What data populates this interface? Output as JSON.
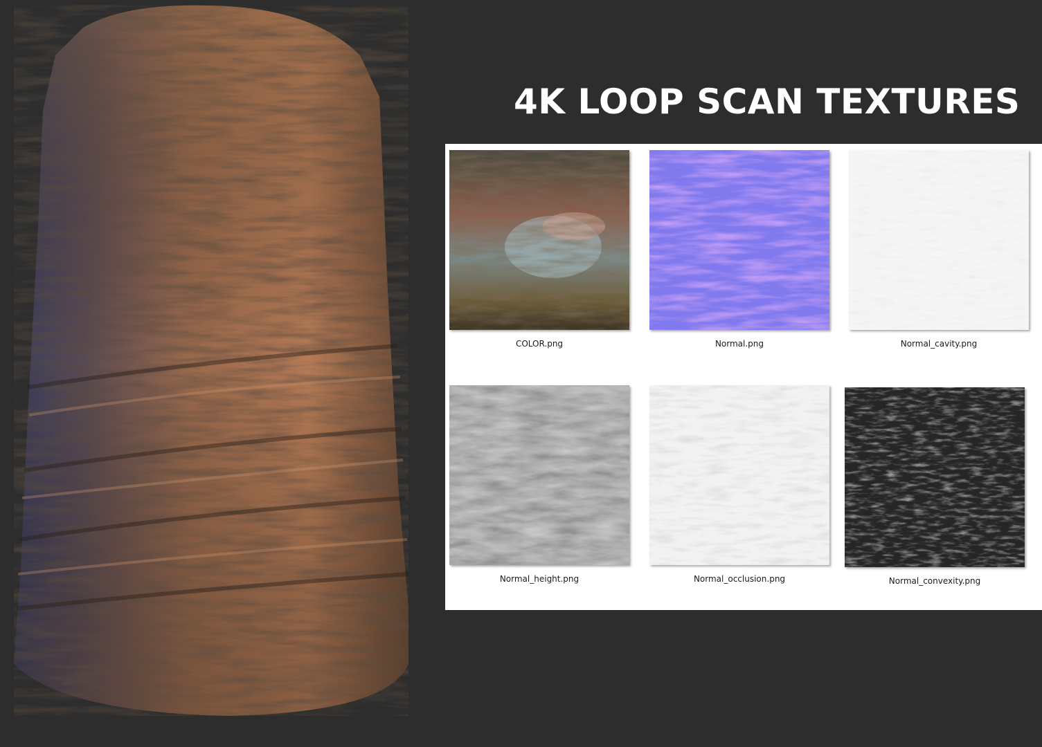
{
  "title": "4K LOOP SCAN TEXTURES",
  "preview": {
    "icon": "rock-scan-cylinder-icon"
  },
  "files": [
    {
      "name": "COLOR.png",
      "icon": "color-map-thumbnail",
      "swatch": "#7a5a48"
    },
    {
      "name": "Normal.png",
      "icon": "normal-map-thumbnail",
      "swatch": "#8a7fe8"
    },
    {
      "name": "Normal_cavity.png",
      "icon": "cavity-map-thumbnail",
      "swatch": "#f4f4f4"
    },
    {
      "name": "Normal_height.png",
      "icon": "height-map-thumbnail",
      "swatch": "#8c8c8c"
    },
    {
      "name": "Normal_occlusion.png",
      "icon": "occlusion-map-thumbnail",
      "swatch": "#ececec"
    },
    {
      "name": "Normal_convexity.png",
      "icon": "convexity-map-thumbnail",
      "swatch": "#2a2a2a"
    }
  ],
  "colors": {
    "background": "#2d2d2d",
    "panel": "#ffffff",
    "title": "#ffffff",
    "rock_warm": "#a56a45",
    "rock_cool": "#4a5a8a"
  }
}
